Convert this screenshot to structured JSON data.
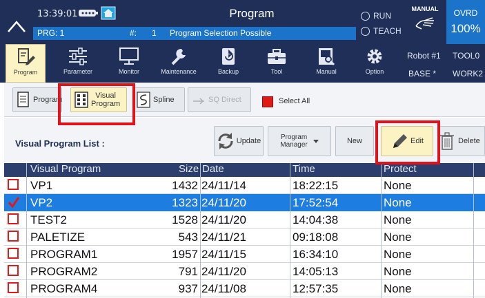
{
  "status": {
    "time": "13:39:01",
    "title": "Program",
    "prg_label": "PRG: 1",
    "hash_label": "#:",
    "hash_value": "1",
    "message": "Program Selection Possible",
    "run_label": "RUN",
    "teach_label": "TEACH",
    "manual_label": "MANUAL",
    "ovrd_label": "OVRD",
    "ovrd_value": "100%"
  },
  "menu": [
    {
      "label": "Program",
      "icon": "program-edit-icon",
      "active": true
    },
    {
      "label": "Parameter",
      "icon": "sliders-icon"
    },
    {
      "label": "Monitor",
      "icon": "monitor-icon"
    },
    {
      "label": "Maintenance",
      "icon": "wrench-icon"
    },
    {
      "label": "Backup",
      "icon": "backup-icon"
    },
    {
      "label": "Tool",
      "icon": "toolbox-icon"
    },
    {
      "label": "Manual",
      "icon": "book-icon"
    },
    {
      "label": "Option",
      "icon": "gear-icon"
    }
  ],
  "robot_info": {
    "robot": "Robot #1",
    "tool": "TOOL0",
    "base": "BASE *",
    "work": "WORK2"
  },
  "subtabs": {
    "program": "Program",
    "visual_line1": "Visual",
    "visual_line2": "Program",
    "spline": "Spline",
    "sq_direct": "SQ Direct",
    "select_all": "Select All"
  },
  "toolbar": {
    "list_label": "Visual Program List :",
    "update": "Update",
    "pm_line1": "Program",
    "pm_line2": "Manager",
    "new": "New",
    "edit": "Edit",
    "delete": "Delete"
  },
  "table": {
    "headers": {
      "name": "Visual Program",
      "size": "Size",
      "date": "Date",
      "time": "Time",
      "protect": "Protect"
    },
    "rows": [
      {
        "name": "VP1",
        "size": "1432",
        "date": "24/11/14",
        "time": "18:22:15",
        "protect": "None",
        "checked": false
      },
      {
        "name": "VP2",
        "size": "1323",
        "date": "24/11/20",
        "time": "17:52:54",
        "protect": "None",
        "checked": true
      },
      {
        "name": "TEST2",
        "size": "1528",
        "date": "24/11/20",
        "time": "14:04:38",
        "protect": "None",
        "checked": false
      },
      {
        "name": "PALETIZE",
        "size": "543",
        "date": "24/11/21",
        "time": "09:18:08",
        "protect": "None",
        "checked": false
      },
      {
        "name": "PROGRAM1",
        "size": "1957",
        "date": "24/11/15",
        "time": "16:34:10",
        "protect": "None",
        "checked": false
      },
      {
        "name": "PROGRAM2",
        "size": "791",
        "date": "24/11/20",
        "time": "14:05:13",
        "protect": "None",
        "checked": false
      },
      {
        "name": "PROGRAM4",
        "size": "937",
        "date": "24/11/08",
        "time": "12:57:35",
        "protect": "None",
        "checked": false
      }
    ]
  },
  "colors": {
    "header_navy": "#1f2f57",
    "accent_blue": "#1b74c9",
    "selected_row": "#1e7de0",
    "active_tab": "#fbf3c4",
    "highlight_red": "#e0121a"
  }
}
